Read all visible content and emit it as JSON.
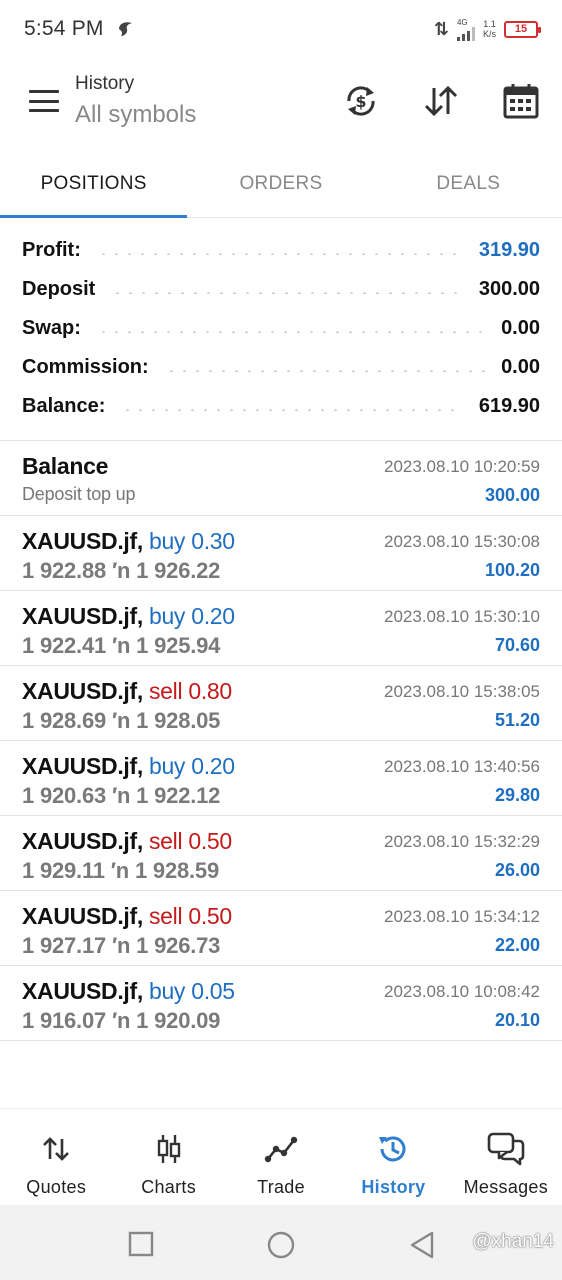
{
  "status_bar": {
    "time": "5:54 PM",
    "network_type": "4G",
    "speed_value": "1.1",
    "speed_unit": "K/s",
    "battery": "15"
  },
  "app_bar": {
    "title": "History",
    "subtitle": "All symbols"
  },
  "tabs": [
    {
      "label": "POSITIONS",
      "active": true
    },
    {
      "label": "ORDERS",
      "active": false
    },
    {
      "label": "DEALS",
      "active": false
    }
  ],
  "summary": {
    "profit_label": "Profit:",
    "profit_value": "319.90",
    "deposit_label": "Deposit",
    "deposit_value": "300.00",
    "swap_label": "Swap:",
    "swap_value": "0.00",
    "commission_label": "Commission:",
    "commission_value": "0.00",
    "balance_label": "Balance:",
    "balance_value": "619.90"
  },
  "deals": [
    {
      "symbol": "Balance",
      "side": "",
      "detail": "Deposit top up",
      "time": "2023.08.10 10:20:59",
      "profit": "300.00"
    },
    {
      "symbol": "XAUUSD.jf,",
      "side": "buy 0.30",
      "detail": "1 922.88 ′n  1 926.22",
      "time": "2023.08.10 15:30:08",
      "profit": "100.20"
    },
    {
      "symbol": "XAUUSD.jf,",
      "side": "buy 0.20",
      "detail": "1 922.41 ′n  1 925.94",
      "time": "2023.08.10 15:30:10",
      "profit": "70.60"
    },
    {
      "symbol": "XAUUSD.jf,",
      "side": "sell 0.80",
      "detail": "1 928.69 ′n  1 928.05",
      "time": "2023.08.10 15:38:05",
      "profit": "51.20"
    },
    {
      "symbol": "XAUUSD.jf,",
      "side": "buy 0.20",
      "detail": "1 920.63 ′n  1 922.12",
      "time": "2023.08.10 13:40:56",
      "profit": "29.80"
    },
    {
      "symbol": "XAUUSD.jf,",
      "side": "sell 0.50",
      "detail": "1 929.11 ′n  1 928.59",
      "time": "2023.08.10 15:32:29",
      "profit": "26.00"
    },
    {
      "symbol": "XAUUSD.jf,",
      "side": "sell 0.50",
      "detail": "1 927.17 ′n  1 926.73",
      "time": "2023.08.10 15:34:12",
      "profit": "22.00"
    },
    {
      "symbol": "XAUUSD.jf,",
      "side": "buy 0.05",
      "detail": "1 916.07 ′n  1 920.09",
      "time": "2023.08.10 10:08:42",
      "profit": "20.10"
    }
  ],
  "bottom_nav": [
    {
      "label": "Quotes",
      "icon": "quotes-arrows-icon"
    },
    {
      "label": "Charts",
      "icon": "candlestick-icon"
    },
    {
      "label": "Trade",
      "icon": "trade-line-icon"
    },
    {
      "label": "History",
      "icon": "history-clock-icon",
      "active": true
    },
    {
      "label": "Messages",
      "icon": "chat-bubbles-icon"
    }
  ],
  "watermark": "@xhan14",
  "colors": {
    "accent_blue": "#2f7fd0",
    "profit_blue": "#1f6fc0",
    "sell_red": "#c41a1a",
    "battery_red": "#d32f2f"
  }
}
